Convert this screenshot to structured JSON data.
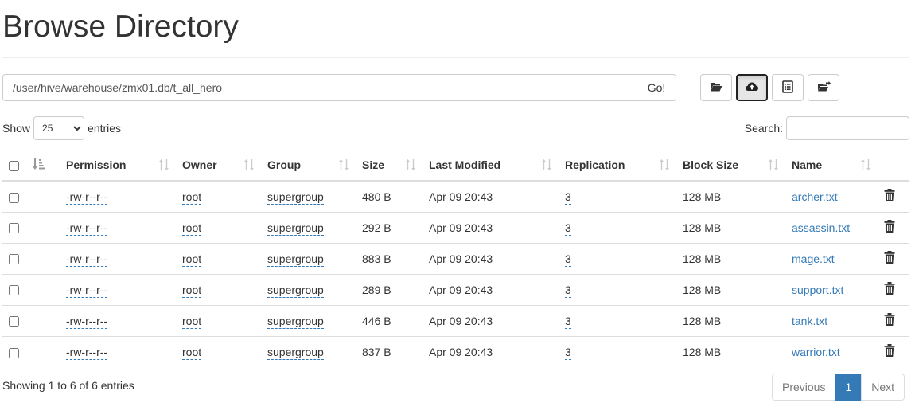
{
  "page": {
    "title": "Browse Directory"
  },
  "path_bar": {
    "value": "/user/hive/warehouse/zmx01.db/t_all_hero",
    "go_label": "Go!"
  },
  "toolbar": {
    "buttons": [
      {
        "icon": "folder-open-icon",
        "active": false
      },
      {
        "icon": "cloud-upload-icon",
        "active": true
      },
      {
        "icon": "list-alt-icon",
        "active": false
      },
      {
        "icon": "folder-move-icon",
        "active": false
      }
    ]
  },
  "length_control": {
    "show_label": "Show",
    "selected": "25",
    "entries_label": "entries"
  },
  "search": {
    "label": "Search:",
    "value": ""
  },
  "table": {
    "headers": {
      "permission": "Permission",
      "owner": "Owner",
      "group": "Group",
      "size": "Size",
      "last_modified": "Last Modified",
      "replication": "Replication",
      "block_size": "Block Size",
      "name": "Name"
    },
    "rows": [
      {
        "permission": "-rw-r--r--",
        "owner": "root",
        "group": "supergroup",
        "size": "480 B",
        "last_modified": "Apr 09 20:43",
        "replication": "3",
        "block_size": "128 MB",
        "name": "archer.txt"
      },
      {
        "permission": "-rw-r--r--",
        "owner": "root",
        "group": "supergroup",
        "size": "292 B",
        "last_modified": "Apr 09 20:43",
        "replication": "3",
        "block_size": "128 MB",
        "name": "assassin.txt"
      },
      {
        "permission": "-rw-r--r--",
        "owner": "root",
        "group": "supergroup",
        "size": "883 B",
        "last_modified": "Apr 09 20:43",
        "replication": "3",
        "block_size": "128 MB",
        "name": "mage.txt"
      },
      {
        "permission": "-rw-r--r--",
        "owner": "root",
        "group": "supergroup",
        "size": "289 B",
        "last_modified": "Apr 09 20:43",
        "replication": "3",
        "block_size": "128 MB",
        "name": "support.txt"
      },
      {
        "permission": "-rw-r--r--",
        "owner": "root",
        "group": "supergroup",
        "size": "446 B",
        "last_modified": "Apr 09 20:43",
        "replication": "3",
        "block_size": "128 MB",
        "name": "tank.txt"
      },
      {
        "permission": "-rw-r--r--",
        "owner": "root",
        "group": "supergroup",
        "size": "837 B",
        "last_modified": "Apr 09 20:43",
        "replication": "3",
        "block_size": "128 MB",
        "name": "warrior.txt"
      }
    ]
  },
  "footer": {
    "info": "Showing 1 to 6 of 6 entries",
    "pagination": {
      "previous": "Previous",
      "current": "1",
      "next": "Next"
    }
  },
  "colors": {
    "link": "#337ab7",
    "active_page": "#337ab7",
    "border": "#dddddd"
  }
}
